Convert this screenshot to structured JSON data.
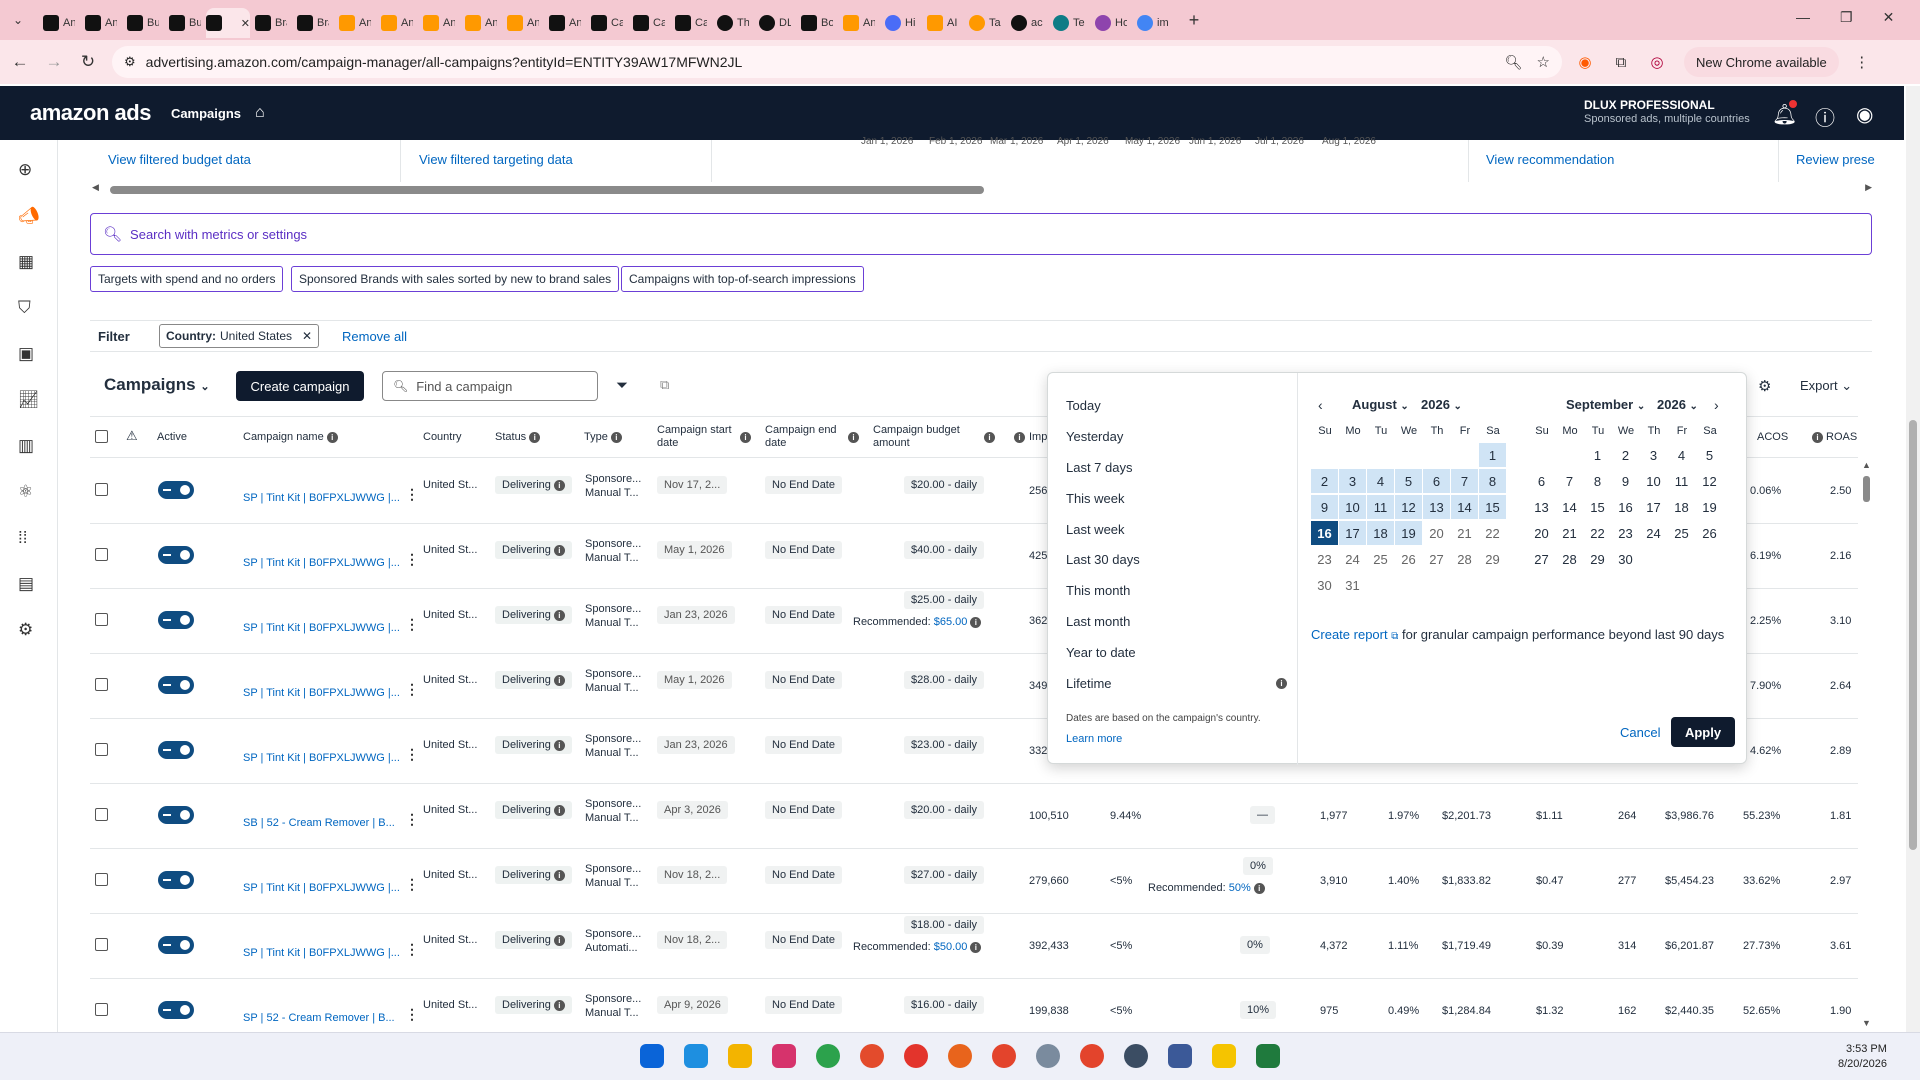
{
  "browser": {
    "tabs": [
      {
        "icon": "amazon-a",
        "text": "An"
      },
      {
        "icon": "amazon-a",
        "text": "An"
      },
      {
        "icon": "amazon-a",
        "text": "Bu"
      },
      {
        "icon": "amazon-a",
        "text": "Bu"
      },
      {
        "icon": "envelope",
        "text": ""
      },
      {
        "icon": "envelope",
        "text": "Bra"
      },
      {
        "icon": "envelope",
        "text": "Bra"
      },
      {
        "icon": "orange-box",
        "text": "An"
      },
      {
        "icon": "orange-box",
        "text": "An"
      },
      {
        "icon": "orange-box",
        "text": "An"
      },
      {
        "icon": "orange-box",
        "text": "An"
      },
      {
        "icon": "orange-box",
        "text": "An"
      },
      {
        "icon": "envelope",
        "text": "An"
      },
      {
        "icon": "envelope",
        "text": "Ca"
      },
      {
        "icon": "envelope",
        "text": "Ca"
      },
      {
        "icon": "envelope",
        "text": "Ca"
      },
      {
        "icon": "circle",
        "text": "Th"
      },
      {
        "icon": "circle",
        "text": "DL"
      },
      {
        "icon": "beta",
        "text": "Bo"
      },
      {
        "icon": "orange-box",
        "text": "An"
      },
      {
        "icon": "history",
        "text": "Hi"
      },
      {
        "icon": "orange-box",
        "text": "AI"
      },
      {
        "icon": "rainbow",
        "text": "Tar"
      },
      {
        "icon": "circle",
        "text": "acc"
      },
      {
        "icon": "teal-circle",
        "text": "Te"
      },
      {
        "icon": "g-purple",
        "text": "Ho"
      },
      {
        "icon": "google",
        "text": "im"
      }
    ],
    "url": "advertising.amazon.com/campaign-manager/all-campaigns?entityId=ENTITY39AW17MFWN2JL",
    "new_chrome": "New Chrome available"
  },
  "header": {
    "logo": "amazon ads",
    "nav_campaigns": "Campaigns",
    "account_name": "DLUX PROFESSIONAL",
    "account_sub": "Sponsored ads, multiple countries"
  },
  "toplinks": {
    "budget": "View filtered budget data",
    "targeting": "View filtered targeting data",
    "recommendation": "View recommendation",
    "review": "Review prese",
    "axis_ticks": [
      "Jan 1, 2026",
      "Feb 1, 2026",
      "Mar 1, 2026",
      "Apr 1, 2026",
      "May 1, 2026",
      "Jun 1, 2026",
      "Jul 1, 2026",
      "Aug 1, 2026"
    ]
  },
  "search": {
    "placeholder": "Search with metrics or settings",
    "chips": [
      "Targets with spend and no orders",
      "Sponsored Brands with sales sorted by new to brand sales",
      "Campaigns with top-of-search impressions"
    ]
  },
  "filter": {
    "label": "Filter",
    "chip_key": "Country:",
    "chip_value": "United States",
    "remove_all": "Remove all"
  },
  "campaigns": {
    "title": "Campaigns",
    "create": "Create campaign",
    "find_placeholder": "Find a campaign",
    "export": "Export"
  },
  "table": {
    "headers": {
      "active": "Active",
      "name": "Campaign name",
      "country": "Country",
      "status": "Status",
      "type": "Type",
      "start": "Campaign start date",
      "end": "Campaign end date",
      "budget": "Campaign budget amount",
      "imp": "Imp",
      "acos": "ACOS",
      "roas": "ROAS"
    },
    "rows": [
      {
        "name": "SP | Tint Kit | B0FPXLJWWG |...",
        "country": "United St...",
        "status": "Delivering",
        "type1": "Sponsore...",
        "type2": "Manual T...",
        "start": "Nov 17, 2...",
        "end": "No End Date",
        "budget": "$20.00 - daily",
        "rec": "",
        "imp": "256",
        "acos": "0.06%",
        "roas": "2.50"
      },
      {
        "name": "SP | Tint Kit | B0FPXLJWWG |...",
        "country": "United St...",
        "status": "Delivering",
        "type1": "Sponsore...",
        "type2": "Manual T...",
        "start": "May 1, 2026",
        "end": "No End Date",
        "budget": "$40.00 - daily",
        "rec": "",
        "imp": "425",
        "acos": "6.19%",
        "roas": "2.16"
      },
      {
        "name": "SP | Tint Kit | B0FPXLJWWG |...",
        "country": "United St...",
        "status": "Delivering",
        "type1": "Sponsore...",
        "type2": "Manual T...",
        "start": "Jan 23, 2026",
        "end": "No End Date",
        "budget": "$25.00 - daily",
        "rec": "$65.00",
        "imp": "362",
        "acos": "2.25%",
        "roas": "3.10"
      },
      {
        "name": "SP | Tint Kit | B0FPXLJWWG |...",
        "country": "United St...",
        "status": "Delivering",
        "type1": "Sponsore...",
        "type2": "Manual T...",
        "start": "May 1, 2026",
        "end": "No End Date",
        "budget": "$28.00 - daily",
        "rec": "",
        "imp": "349",
        "acos": "7.90%",
        "roas": "2.64"
      },
      {
        "name": "SP | Tint Kit | B0FPXLJWWG |...",
        "country": "United St...",
        "status": "Delivering",
        "type1": "Sponsore...",
        "type2": "Manual T...",
        "start": "Jan 23, 2026",
        "end": "No End Date",
        "budget": "$23.00 - daily",
        "rec": "",
        "imp": "332",
        "acos": "4.62%",
        "roas": "2.89"
      },
      {
        "name": "SB | 52 - Cream Remover | B...",
        "country": "United St...",
        "status": "Delivering",
        "type1": "Sponsore...",
        "type2": "Manual T...",
        "start": "Apr 3, 2026",
        "end": "No End Date",
        "budget": "$20.00 - daily",
        "rec": "",
        "imp": "100,510",
        "top": "9.44%",
        "bidadj": "—",
        "bidrec": "",
        "clicks": "1,977",
        "ctr": "1.97%",
        "spend": "$2,201.73",
        "cpc": "$1.11",
        "orders": "264",
        "sales": "$3,986.76",
        "acos": "55.23%",
        "roas": "1.81"
      },
      {
        "name": "SP | Tint Kit | B0FPXLJWWG |...",
        "country": "United St...",
        "status": "Delivering",
        "type1": "Sponsore...",
        "type2": "Manual T...",
        "start": "Nov 18, 2...",
        "end": "No End Date",
        "budget": "$27.00 - daily",
        "rec": "",
        "imp": "279,660",
        "top": "<5%",
        "bidadj": "0%",
        "bidrec": "50%",
        "clicks": "3,910",
        "ctr": "1.40%",
        "spend": "$1,833.82",
        "cpc": "$0.47",
        "orders": "277",
        "sales": "$5,454.23",
        "acos": "33.62%",
        "roas": "2.97"
      },
      {
        "name": "SP | Tint Kit | B0FPXLJWWG |...",
        "country": "United St...",
        "status": "Delivering",
        "type1": "Sponsore...",
        "type2": "Automati...",
        "start": "Nov 18, 2...",
        "end": "No End Date",
        "budget": "$18.00 - daily",
        "rec": "$50.00",
        "imp": "392,433",
        "top": "<5%",
        "bidadj": "0%",
        "bidrec": "",
        "clicks": "4,372",
        "ctr": "1.11%",
        "spend": "$1,719.49",
        "cpc": "$0.39",
        "orders": "314",
        "sales": "$6,201.87",
        "acos": "27.73%",
        "roas": "3.61"
      },
      {
        "name": "SP | 52 - Cream Remover | B...",
        "country": "United St...",
        "status": "Delivering",
        "type1": "Sponsore...",
        "type2": "Manual T...",
        "start": "Apr 9, 2026",
        "end": "No End Date",
        "budget": "$16.00 - daily",
        "rec": "",
        "imp": "199,838",
        "top": "<5%",
        "bidadj": "10%",
        "bidrec": "",
        "clicks": "975",
        "ctr": "0.49%",
        "spend": "$1,284.84",
        "cpc": "$1.32",
        "orders": "162",
        "sales": "$2,440.35",
        "acos": "52.65%",
        "roas": "1.90"
      }
    ],
    "recommended_label": "Recommended:"
  },
  "datepicker": {
    "presets": [
      "Today",
      "Yesterday",
      "Last 7 days",
      "This week",
      "Last week",
      "Last 30 days",
      "This month",
      "Last month",
      "Year to date",
      "Lifetime"
    ],
    "note": "Dates are based on the campaign's country.",
    "learn_more": "Learn more",
    "month1": "August",
    "year1": "2026",
    "month2": "September",
    "year2": "2026",
    "dow": [
      "Su",
      "Mo",
      "Tu",
      "We",
      "Th",
      "Fr",
      "Sa"
    ],
    "create_report": "Create report",
    "report_text": "for granular campaign performance beyond last 90 days",
    "cancel": "Cancel",
    "apply": "Apply",
    "range_start": 16,
    "range_end": 19
  },
  "taskbar": {
    "time": "3:53 PM",
    "date": "8/20/2026"
  }
}
